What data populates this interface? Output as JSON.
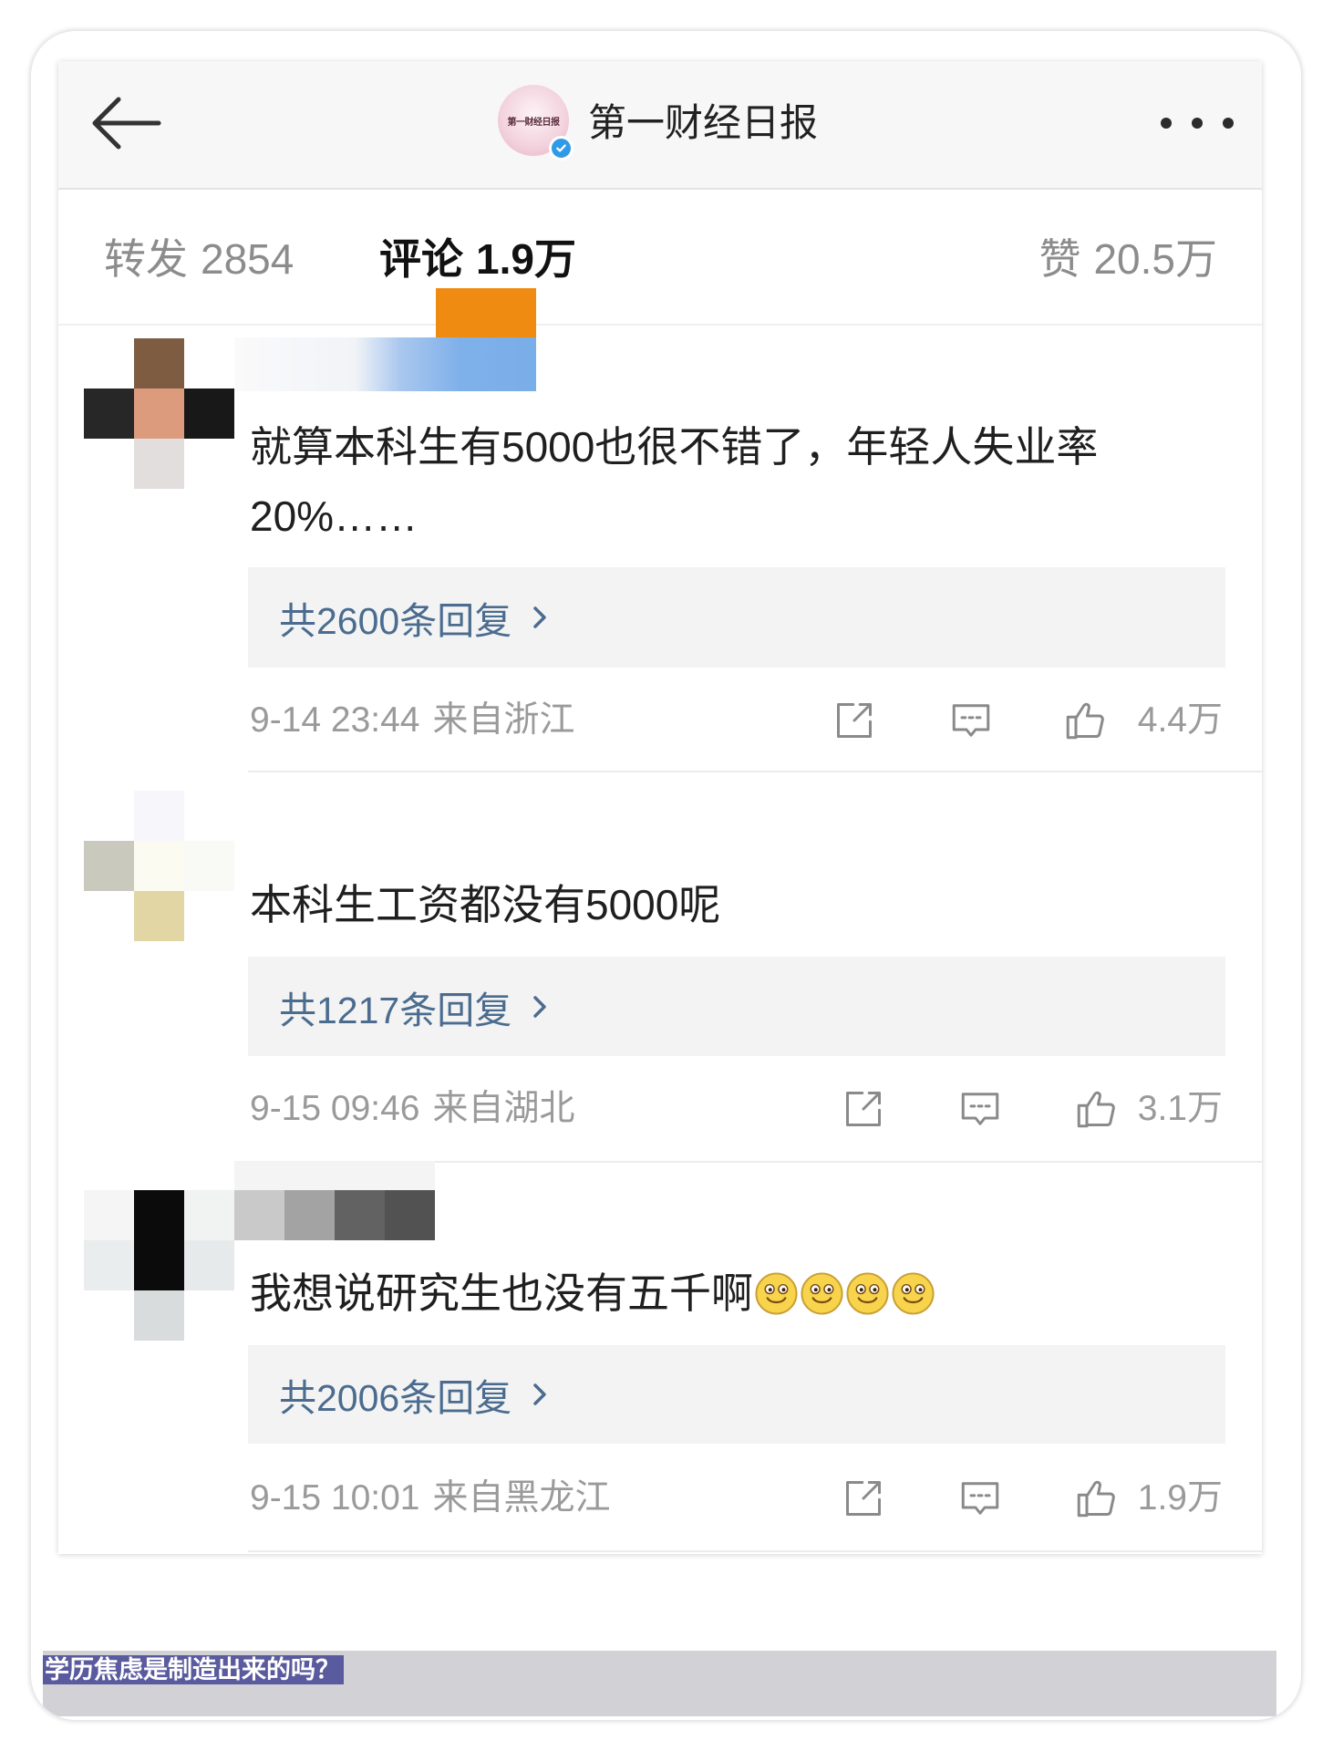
{
  "header": {
    "account_name": "第一财经日报",
    "avatar_text": "第一财经日报",
    "icons": {
      "back": "arrow-left-icon",
      "verified": "verified-badge-icon",
      "more": "more-dots-icon"
    }
  },
  "tabs": [
    {
      "label": "转发",
      "count": "2854"
    },
    {
      "label": "评论",
      "count": "1.9万"
    },
    {
      "label": "赞",
      "count": "20.5万"
    }
  ],
  "comments": [
    {
      "text_lines": [
        "就算本科生有5000也很不错了，年轻人失业率",
        "20%……"
      ],
      "reply_label": "共2600条回复",
      "time": "9-14 23:44",
      "location": "来自浙江",
      "likes": "4.4万"
    },
    {
      "text_lines": [
        "本科生工资都没有5000呢"
      ],
      "reply_label": "共1217条回复",
      "time": "9-15 09:46",
      "location": "来自湖北",
      "likes": "3.1万"
    },
    {
      "text_lines": [
        "我想说研究生也没有五千啊"
      ],
      "emojis": [
        "smile-emoji-icon",
        "smile-emoji-icon",
        "smile-emoji-icon",
        "smile-emoji-icon"
      ],
      "reply_label": "共2006条回复",
      "time": "9-15 10:01",
      "location": "来自黑龙江",
      "likes": "1.9万"
    }
  ],
  "action_icons": [
    "share-icon",
    "comment-icon",
    "like-icon"
  ],
  "caption": "学历焦虑是制造出来的吗？",
  "colors": {
    "reply_link": "#4b6c8f",
    "meta_gray": "#9a9a9a",
    "verified_blue": "#2f9be6",
    "caption_bg": "#5a5a9e"
  }
}
